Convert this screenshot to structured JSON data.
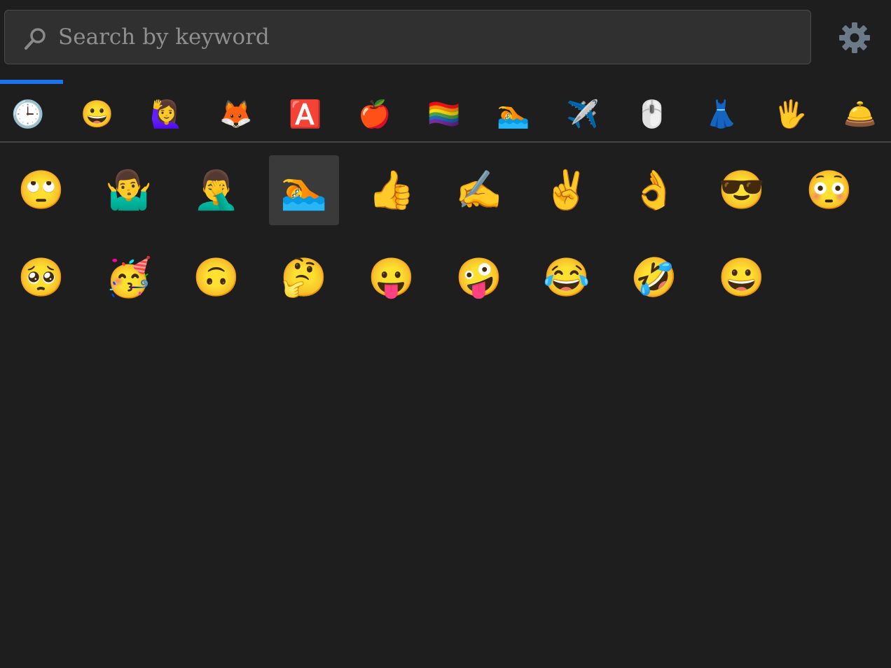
{
  "search": {
    "placeholder": "Search by keyword",
    "value": ""
  },
  "settings": {
    "icon": "gear-icon",
    "color": "#6b7a88"
  },
  "accent_color": "#1a73e8",
  "categories": [
    {
      "name": "recent",
      "icon": "clock-icon",
      "glyph": "🕒"
    },
    {
      "name": "smileys",
      "icon": "smiley-icon",
      "glyph": "😀"
    },
    {
      "name": "people",
      "icon": "person-raising-hand-icon",
      "glyph": "🙋‍♀️"
    },
    {
      "name": "animals",
      "icon": "fox-icon",
      "glyph": "🦊"
    },
    {
      "name": "symbols",
      "icon": "letter-a-icon",
      "glyph": "🅰️"
    },
    {
      "name": "food",
      "icon": "apple-icon",
      "glyph": "🍎"
    },
    {
      "name": "flags",
      "icon": "rainbow-flag-icon",
      "glyph": "🏳️‍🌈"
    },
    {
      "name": "activities",
      "icon": "swimmer-icon",
      "glyph": "🏊"
    },
    {
      "name": "travel",
      "icon": "airplane-icon",
      "glyph": "✈️"
    },
    {
      "name": "objects",
      "icon": "mouse-icon",
      "glyph": "🖱️"
    },
    {
      "name": "clothing",
      "icon": "dress-icon",
      "glyph": "👗"
    },
    {
      "name": "gestures",
      "icon": "raised-hand-icon",
      "glyph": "🖐️"
    },
    {
      "name": "alerts",
      "icon": "bell-icon",
      "glyph": "🛎️"
    }
  ],
  "active_category": 0,
  "emojis": [
    {
      "name": "face-with-rolling-eyes",
      "glyph": "🙄"
    },
    {
      "name": "man-shrugging",
      "glyph": "🤷‍♂️"
    },
    {
      "name": "man-facepalming",
      "glyph": "🤦‍♂️"
    },
    {
      "name": "person-swimming",
      "glyph": "🏊"
    },
    {
      "name": "thumbs-up",
      "glyph": "👍"
    },
    {
      "name": "writing-hand",
      "glyph": "✍️"
    },
    {
      "name": "victory-hand",
      "glyph": "✌️"
    },
    {
      "name": "ok-hand",
      "glyph": "👌"
    },
    {
      "name": "smiling-face-with-sunglasses",
      "glyph": "😎"
    },
    {
      "name": "flushed-face",
      "glyph": "😳"
    },
    {
      "name": "pleading-face",
      "glyph": "🥺"
    },
    {
      "name": "partying-face",
      "glyph": "🥳"
    },
    {
      "name": "upside-down-face",
      "glyph": "🙃"
    },
    {
      "name": "thinking-face",
      "glyph": "🤔"
    },
    {
      "name": "face-with-tongue",
      "glyph": "😛"
    },
    {
      "name": "zany-face",
      "glyph": "🤪"
    },
    {
      "name": "face-with-tears-of-joy",
      "glyph": "😂"
    },
    {
      "name": "rolling-on-the-floor-laughing",
      "glyph": "🤣"
    },
    {
      "name": "grinning-face",
      "glyph": "😀"
    }
  ],
  "selected_emoji": 3
}
